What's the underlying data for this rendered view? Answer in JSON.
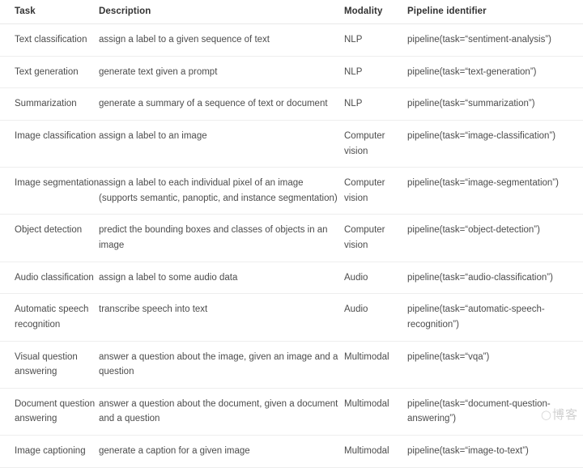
{
  "table": {
    "columns": [
      {
        "key": "task",
        "label": "Task"
      },
      {
        "key": "description",
        "label": "Description"
      },
      {
        "key": "modality",
        "label": "Modality"
      },
      {
        "key": "pipeline",
        "label": "Pipeline identifier"
      }
    ],
    "rows": [
      {
        "task": [
          "Text classification"
        ],
        "description": [
          "assign a label to a given sequence of text"
        ],
        "modality": [
          "NLP"
        ],
        "pipeline": [
          "pipeline(task=“sentiment-analysis”)"
        ]
      },
      {
        "task": [
          "Text generation"
        ],
        "description": [
          "generate text given a prompt"
        ],
        "modality": [
          "NLP"
        ],
        "pipeline": [
          "pipeline(task=“text-generation”)"
        ]
      },
      {
        "task": [
          "Summarization"
        ],
        "description": [
          "generate a summary of a sequence of text or document"
        ],
        "modality": [
          "NLP"
        ],
        "pipeline": [
          "pipeline(task=“summarization”)"
        ]
      },
      {
        "task": [
          "Image classification"
        ],
        "description": [
          "assign a label to an image"
        ],
        "modality": [
          "Computer",
          "vision"
        ],
        "pipeline": [
          "pipeline(task=“image-classification”)"
        ]
      },
      {
        "task": [
          "Image segmentation"
        ],
        "description": [
          "assign a label to each individual pixel of an image",
          "(supports semantic, panoptic, and instance segmentation)"
        ],
        "modality": [
          "Computer",
          "vision"
        ],
        "pipeline": [
          "pipeline(task=“image-segmentation”)"
        ]
      },
      {
        "task": [
          "Object detection"
        ],
        "description": [
          "predict the bounding boxes and classes of objects in an",
          "image"
        ],
        "modality": [
          "Computer",
          "vision"
        ],
        "pipeline": [
          "pipeline(task=“object-detection”)"
        ]
      },
      {
        "task": [
          "Audio classification"
        ],
        "description": [
          "assign a label to some audio data"
        ],
        "modality": [
          "Audio"
        ],
        "pipeline": [
          "pipeline(task=“audio-classification”)"
        ]
      },
      {
        "task": [
          "Automatic speech",
          "recognition"
        ],
        "description": [
          "transcribe speech into text"
        ],
        "modality": [
          "Audio"
        ],
        "pipeline": [
          "pipeline(task=“automatic-speech-",
          "recognition”)"
        ]
      },
      {
        "task": [
          "Visual question",
          "answering"
        ],
        "description": [
          "answer a question about the image, given an image and a",
          "question"
        ],
        "modality": [
          "Multimodal"
        ],
        "pipeline": [
          "pipeline(task=“vqa”)"
        ]
      },
      {
        "task": [
          "Document question",
          "answering"
        ],
        "description": [
          "answer a question about the document, given a document",
          "and a question"
        ],
        "modality": [
          "Multimodal"
        ],
        "pipeline": [
          "pipeline(task=“document-question-",
          "answering”)"
        ]
      },
      {
        "task": [
          "Image captioning"
        ],
        "description": [
          "generate a caption for a given image"
        ],
        "modality": [
          "Multimodal"
        ],
        "pipeline": [
          "pipeline(task=“image-to-text”)"
        ]
      }
    ]
  },
  "watermark": {
    "text": "博客",
    "ring": "○"
  },
  "colors": {
    "text": "#4c4c4c",
    "header_text": "#333333",
    "divider": "#eeeeee",
    "background": "#ffffff"
  }
}
